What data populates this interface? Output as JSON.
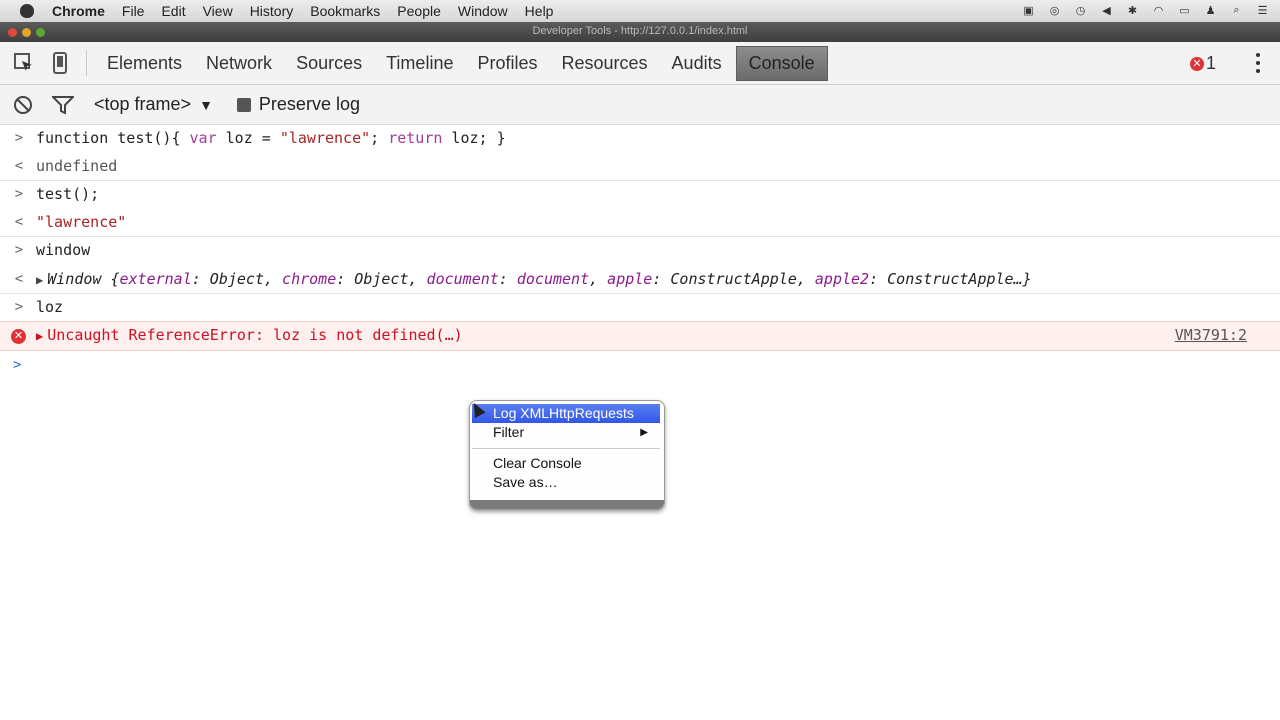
{
  "menubar": {
    "app": "Chrome",
    "items": [
      "File",
      "Edit",
      "View",
      "History",
      "Bookmarks",
      "People",
      "Window",
      "Help"
    ]
  },
  "titlebar": {
    "title": "Developer Tools - http://127.0.0.1/index.html"
  },
  "toolbar": {
    "tabs": [
      "Elements",
      "Network",
      "Sources",
      "Timeline",
      "Profiles",
      "Resources",
      "Audits",
      "Console"
    ],
    "active_tab": "Console",
    "error_count": "1"
  },
  "filterbar": {
    "context": "<top frame>",
    "preserve_log": "Preserve log"
  },
  "console": {
    "line1_pre": "function test(){ ",
    "line1_kw1": "var",
    "line1_mid": " loz = ",
    "line1_str": "\"lawrence\"",
    "line1_semi": "; ",
    "line1_kw2": "return",
    "line1_end": " loz; }",
    "result1": "undefined",
    "line2": "test();",
    "result2": "\"lawrence\"",
    "line3": "window",
    "window_obj": {
      "prefix": "Window {",
      "k1": "external",
      "v1": "Object",
      "k2": "chrome",
      "v2": "Object",
      "k3": "document",
      "v3": "document",
      "k4": "apple",
      "v4": "ConstructApple",
      "k5": "apple2",
      "v5": "ConstructApple…}"
    },
    "line4": "loz",
    "error_text": "Uncaught ReferenceError: loz is not defined(…)",
    "error_source": "VM3791:2"
  },
  "context_menu": {
    "items": [
      "Log XMLHttpRequests",
      "Filter",
      "Clear Console",
      "Save as…"
    ]
  },
  "colors": {
    "error": "#d33333",
    "keyword": "#a33a9a",
    "string": "#a72424",
    "highlight": "#3d63e8"
  }
}
